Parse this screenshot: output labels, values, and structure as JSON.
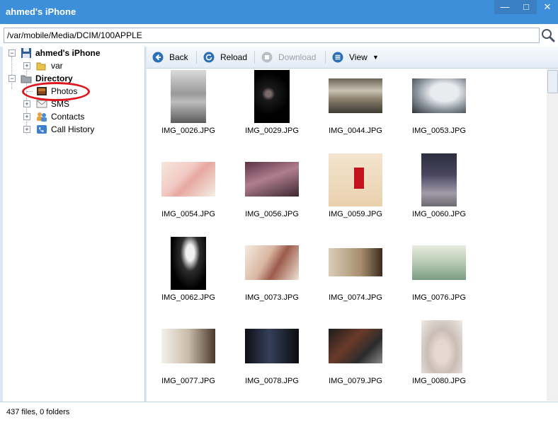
{
  "window": {
    "title": "ahmed's iPhone",
    "buttons": {
      "minimize": "—",
      "maximize": "□",
      "close": "✕"
    }
  },
  "address": {
    "path": "/var/mobile/Media/DCIM/100APPLE"
  },
  "tree": {
    "device": "ahmed's iPhone",
    "var": "var",
    "directory": "Directory",
    "photos": "Photos",
    "sms": "SMS",
    "contacts": "Contacts",
    "call_history": "Call History"
  },
  "toolbar": {
    "back": "Back",
    "reload": "Reload",
    "download": "Download",
    "view": "View"
  },
  "files": [
    "IMG_0026.JPG",
    "IMG_0029.JPG",
    "IMG_0044.JPG",
    "IMG_0053.JPG",
    "IMG_0054.JPG",
    "IMG_0056.JPG",
    "IMG_0059.JPG",
    "IMG_0060.JPG",
    "IMG_0062.JPG",
    "IMG_0073.JPG",
    "IMG_0074.JPG",
    "IMG_0076.JPG",
    "IMG_0077.JPG",
    "IMG_0078.JPG",
    "IMG_0079.JPG",
    "IMG_0080.JPG"
  ],
  "status": {
    "summary": "437 files, 0 folders"
  },
  "colors": {
    "title_bar": "#3c8fd8",
    "highlight": "#e0161e",
    "accent": "#2a6fb8"
  }
}
